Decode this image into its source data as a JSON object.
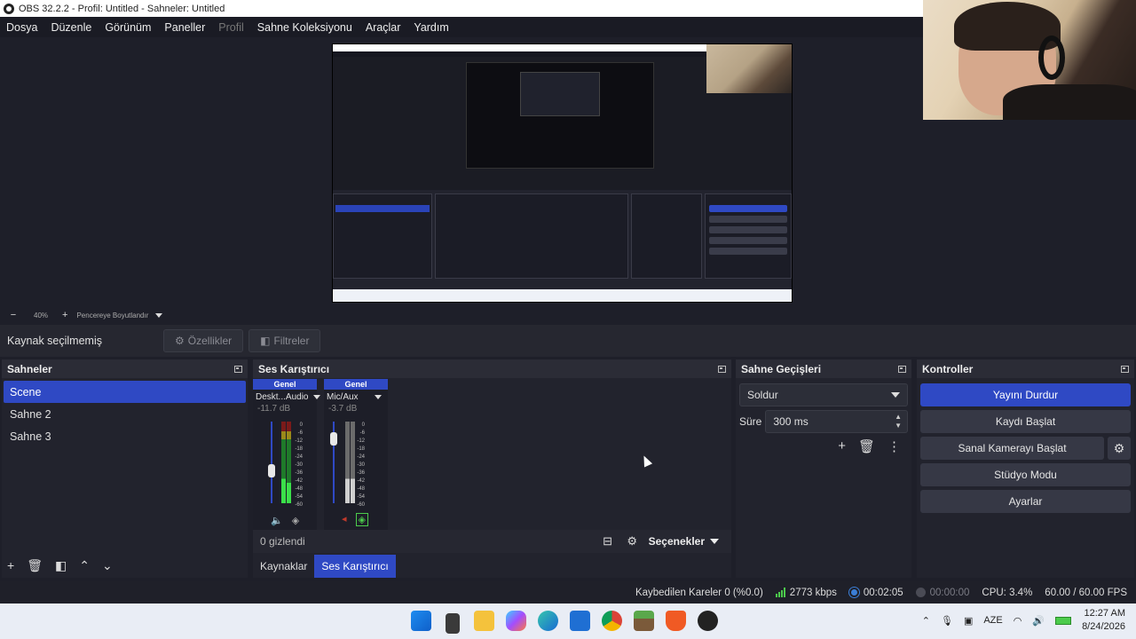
{
  "window": {
    "title": "OBS 32.2.2 - Profil: Untitled - Sahneler: Untitled"
  },
  "menu": [
    {
      "label": "Dosya",
      "enabled": true
    },
    {
      "label": "Düzenle",
      "enabled": true
    },
    {
      "label": "Görünüm",
      "enabled": true
    },
    {
      "label": "Paneller",
      "enabled": true
    },
    {
      "label": "Profil",
      "enabled": false
    },
    {
      "label": "Sahne Koleksiyonu",
      "enabled": true
    },
    {
      "label": "Araçlar",
      "enabled": true
    },
    {
      "label": "Yardım",
      "enabled": true
    }
  ],
  "zoom": {
    "minus": "−",
    "value": "40%",
    "plus": "+",
    "fit_label": "Pencereye Boyutlandır"
  },
  "source_bar": {
    "status": "Kaynak seçilmemiş",
    "properties": "Özellikler",
    "filters": "Filtreler"
  },
  "scenes": {
    "title": "Sahneler",
    "items": [
      {
        "label": "Scene",
        "selected": true
      },
      {
        "label": "Sahne 2",
        "selected": false
      },
      {
        "label": "Sahne 3",
        "selected": false
      }
    ]
  },
  "mixer": {
    "title": "Ses Karıştırıcı",
    "channels": [
      {
        "header": "Genel",
        "name": "Deskt...Audio",
        "db": "-11.7 dB",
        "level": 0.38
      },
      {
        "header": "Genel",
        "name": "Mic/Aux",
        "db": "-3.7 dB",
        "level": 0.85
      }
    ],
    "ticks": [
      "0",
      "-6",
      "-12",
      "-18",
      "-24",
      "-30",
      "-36",
      "-42",
      "-48",
      "-54",
      "-60"
    ],
    "hidden": "0 gizlendi",
    "options": "Seçenekler",
    "tabs": [
      {
        "label": "Kaynaklar",
        "active": false
      },
      {
        "label": "Ses Karıştırıcı",
        "active": true
      }
    ]
  },
  "transitions": {
    "title": "Sahne Geçişleri",
    "selected": "Soldur",
    "duration_label": "Süre",
    "duration_value": "300 ms"
  },
  "controls": {
    "title": "Kontroller",
    "stop_stream": "Yayını Durdur",
    "start_recording": "Kaydı Başlat",
    "start_virtual_cam": "Sanal Kamerayı Başlat",
    "studio_mode": "Stüdyo Modu",
    "settings": "Ayarlar"
  },
  "status": {
    "dropped": "Kaybedilen Kareler 0 (%0.0)",
    "bitrate": "2773 kbps",
    "live_time": "00:02:05",
    "rec_time": "00:00:00",
    "cpu": "CPU: 3.4%",
    "fps": "60.00 / 60.00 FPS"
  },
  "taskbar": {
    "lang": "AZE",
    "time": "12:27 AM",
    "date": "8/24/2026",
    "apps": [
      "windows-start",
      "file-explorer",
      "folder",
      "copilot",
      "edge",
      "store",
      "chrome",
      "minecraft",
      "brave",
      "obs"
    ]
  },
  "colors": {
    "accent": "#2f49c4",
    "background": "#1e1f29",
    "panel": "#22232d"
  }
}
